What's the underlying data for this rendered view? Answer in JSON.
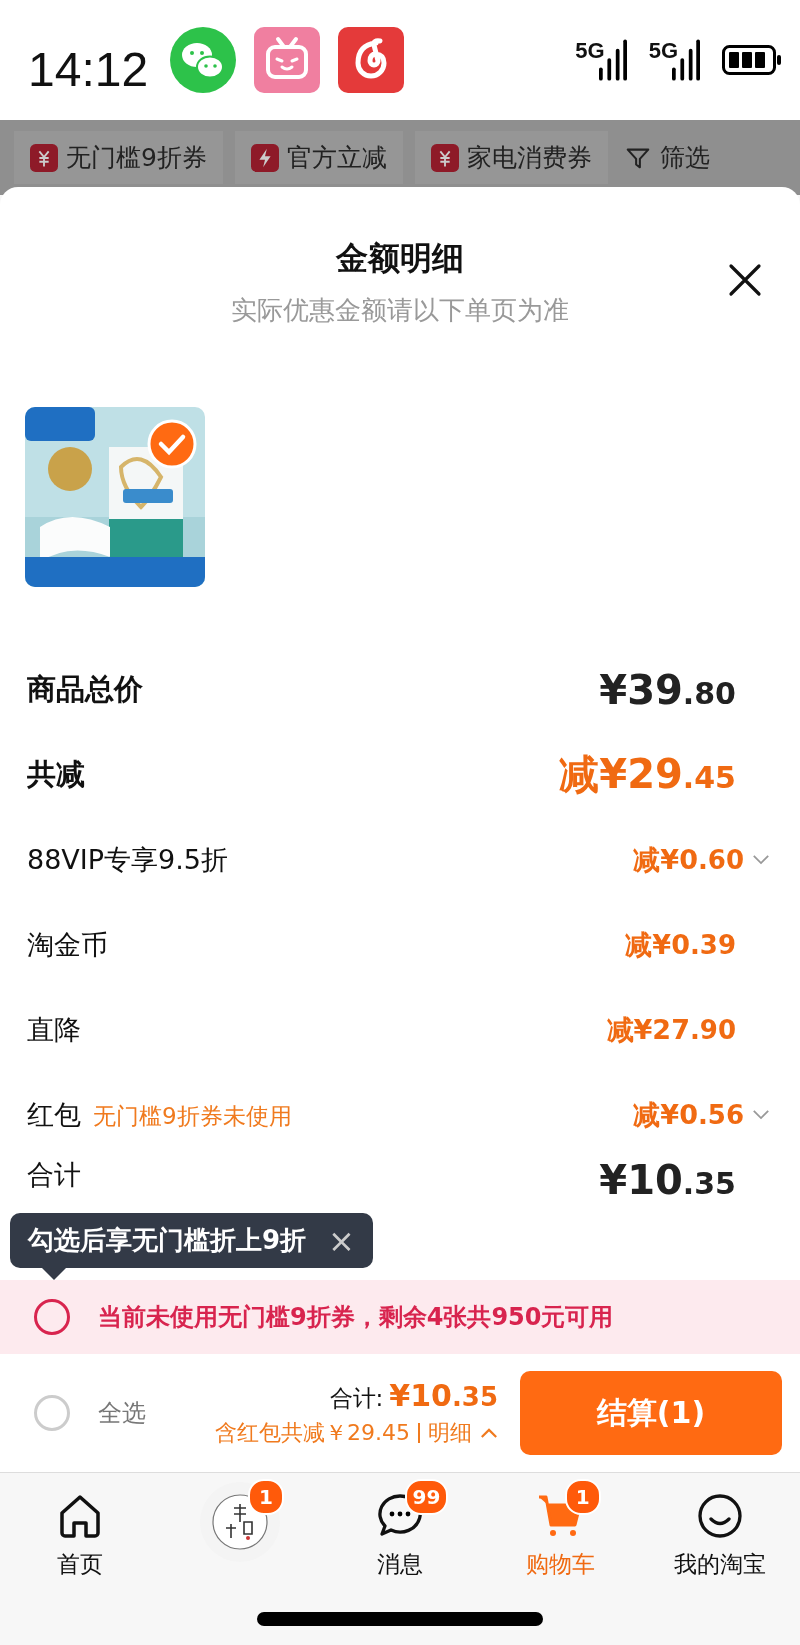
{
  "status_bar": {
    "time": "14:12",
    "network_labels": [
      "5G",
      "5G"
    ]
  },
  "filter_chips": [
    {
      "kind": "coupon",
      "label": "无门槛9折券"
    },
    {
      "kind": "bolt",
      "label": "官方立减"
    },
    {
      "kind": "coupon",
      "label": "家电消费券"
    },
    {
      "kind": "filter",
      "label": "筛选"
    }
  ],
  "sheet": {
    "title": "金额明细",
    "subtitle": "实际优惠金额请以下单页为准",
    "product": {
      "kind": "picture",
      "selected": true
    },
    "rows": [
      {
        "kind": "total",
        "label": "商品总价",
        "amount": "¥39.80",
        "discount": false,
        "expandable": false
      },
      {
        "kind": "total",
        "label": "共减",
        "amount": "减¥29.45",
        "discount": true,
        "expandable": false
      },
      {
        "kind": "detail",
        "label": "88VIP专享9.5折",
        "amount": "减¥0.60",
        "discount": true,
        "expandable": true
      },
      {
        "kind": "detail",
        "label": "淘金币",
        "amount": "减¥0.39",
        "discount": true,
        "expandable": false
      },
      {
        "kind": "detail",
        "label": "直降",
        "amount": "减¥27.90",
        "discount": true,
        "expandable": false
      },
      {
        "kind": "detail",
        "label": "红包",
        "note": "无门槛9折券未使用",
        "amount": "减¥0.56",
        "discount": true,
        "expandable": true
      },
      {
        "kind": "grand",
        "label": "合计",
        "amount": "¥10.35",
        "discount": false,
        "expandable": false
      }
    ]
  },
  "tooltip": {
    "text": "勾选后享无门槛折上9折",
    "close": "×"
  },
  "coupon_bar": {
    "checked": false,
    "text": "当前未使用无门槛9折券，剩余4张共950元可用"
  },
  "checkout": {
    "select_all": {
      "checked": false,
      "label": "全选"
    },
    "total_label": "合计:",
    "total": "¥10.35",
    "savings": "含红包共减￥29.45",
    "details_link": "明细",
    "button": "结算(1)"
  },
  "tab_bar": [
    {
      "kind": "home",
      "label": "首页",
      "selected": false
    },
    {
      "kind": "shop",
      "badge": "1",
      "selected": false
    },
    {
      "kind": "messages",
      "label": "消息",
      "badge": "99",
      "selected": false
    },
    {
      "kind": "cart",
      "label": "购物车",
      "badge": "1",
      "selected": true
    },
    {
      "kind": "profile",
      "label": "我的淘宝",
      "selected": false
    }
  ]
}
